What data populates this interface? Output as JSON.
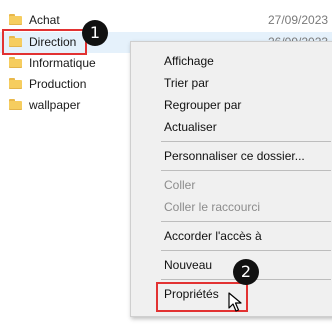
{
  "files": [
    {
      "name": "Achat",
      "date": "27/09/2023 1"
    },
    {
      "name": "Direction",
      "date": "26/09/2023 1"
    },
    {
      "name": "Informatique",
      "date": ""
    },
    {
      "name": "Production",
      "date": ""
    },
    {
      "name": "wallpaper",
      "date": ""
    }
  ],
  "badges": {
    "one": "1",
    "two": "2"
  },
  "menu": {
    "affichage": "Affichage",
    "trier": "Trier par",
    "regrouper": "Regrouper par",
    "actualiser": "Actualiser",
    "personnaliser": "Personnaliser ce dossier...",
    "coller": "Coller",
    "coller_raccourci": "Coller le raccourci",
    "accorder": "Accorder l'accès à",
    "nouveau": "Nouveau",
    "proprietes": "Propriétés"
  },
  "icons": {
    "folder": "folder-icon",
    "cursor": "mouse-pointer-icon"
  },
  "colors": {
    "annotation_red": "#e23232",
    "selection": "#e5f1fb",
    "folder": "#f6cd5f",
    "menu_bg": "#f0f0f0"
  }
}
